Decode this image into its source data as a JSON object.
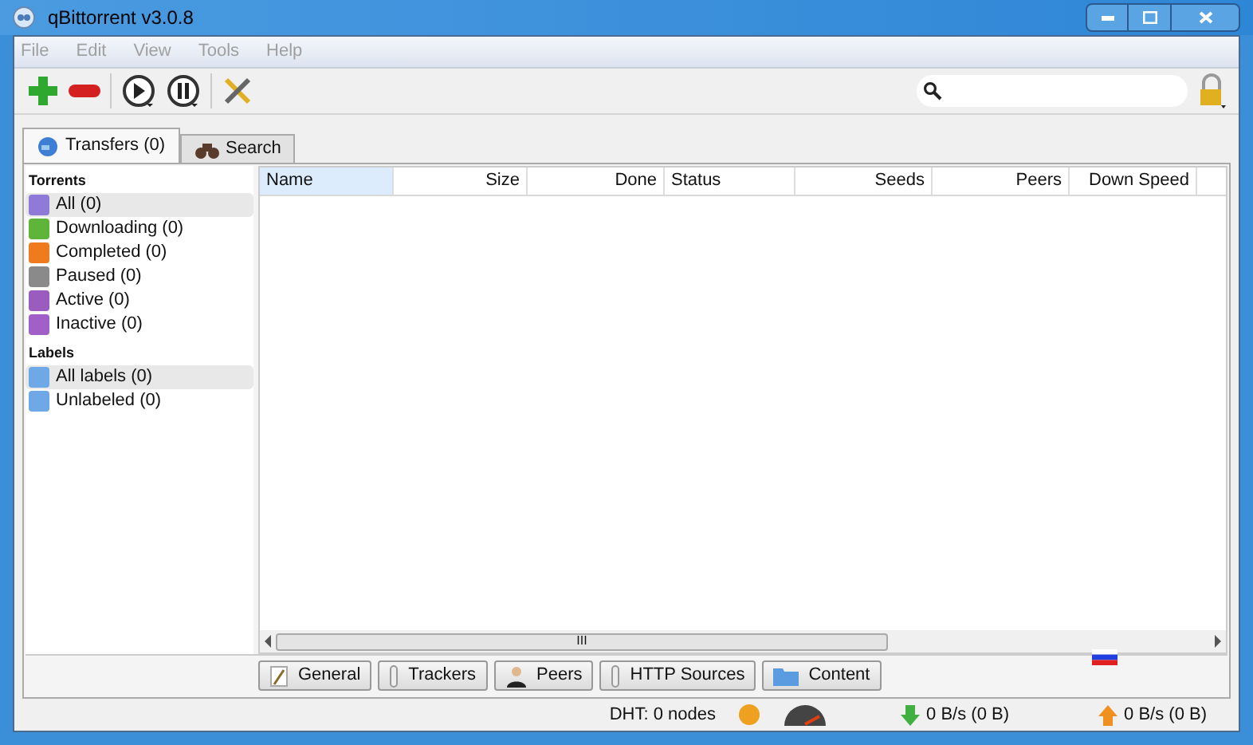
{
  "window": {
    "title": "qBittorrent v3.0.8"
  },
  "menu": [
    "File",
    "Edit",
    "View",
    "Tools",
    "Help"
  ],
  "tabs": [
    {
      "label": "Transfers (0)",
      "kind": "transfers",
      "selected": true
    },
    {
      "label": "Search",
      "kind": "search",
      "selected": false
    }
  ],
  "sidebar": {
    "sections": [
      {
        "heading": "Torrents",
        "items": [
          {
            "label": "All (0)",
            "color": "#8f7ad8",
            "selected": true
          },
          {
            "label": "Downloading (0)",
            "color": "#5fb43a",
            "selected": false
          },
          {
            "label": "Completed (0)",
            "color": "#f07a1e",
            "selected": false
          },
          {
            "label": "Paused (0)",
            "color": "#8a8a8a",
            "selected": false
          },
          {
            "label": "Active (0)",
            "color": "#9b5cc0",
            "selected": false
          },
          {
            "label": "Inactive (0)",
            "color": "#a060c8",
            "selected": false
          }
        ]
      },
      {
        "heading": "Labels",
        "items": [
          {
            "label": "All labels (0)",
            "color": "#6fa8e6",
            "selected": true
          },
          {
            "label": "Unlabeled (0)",
            "color": "#6fa8e6",
            "selected": false
          }
        ]
      }
    ]
  },
  "table": {
    "columns": [
      {
        "label": "Name",
        "kind": "text",
        "selected": true
      },
      {
        "label": "Size",
        "kind": "number",
        "selected": false
      },
      {
        "label": "Done",
        "kind": "number",
        "selected": false
      },
      {
        "label": "Status",
        "kind": "text",
        "selected": false
      },
      {
        "label": "Seeds",
        "kind": "number",
        "selected": false
      },
      {
        "label": "Peers",
        "kind": "number",
        "selected": false
      },
      {
        "label": "Down Speed",
        "kind": "number",
        "selected": false
      }
    ]
  },
  "scrollbar_grip": "III",
  "detail_tabs": [
    {
      "label": "General",
      "kind": "general"
    },
    {
      "label": "Trackers",
      "kind": "trackers"
    },
    {
      "label": "Peers",
      "kind": "peers"
    },
    {
      "label": "HTTP Sources",
      "kind": "http"
    },
    {
      "label": "Content",
      "kind": "content"
    }
  ],
  "status_bar": {
    "dht": "DHT: 0 nodes",
    "download": "0 B/s (0 B)",
    "upload": "0 B/s (0 B)"
  }
}
